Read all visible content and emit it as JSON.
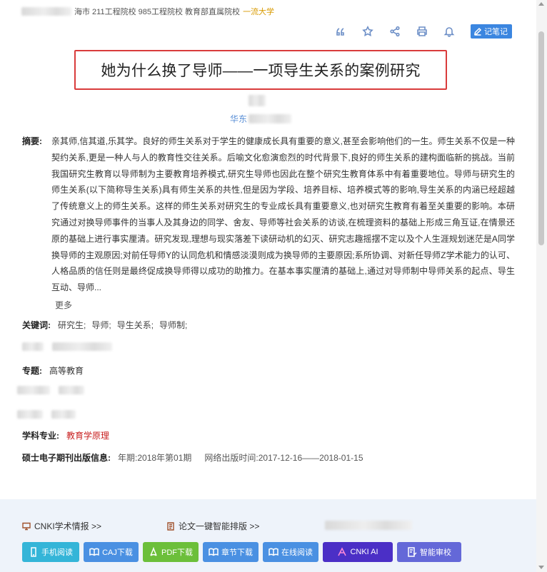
{
  "header": {
    "tags_text": "海市 211工程院校 985工程院校 教育部直属院校",
    "tag_highlight": "一流大学"
  },
  "toolbar": {
    "icons": [
      "quote-icon",
      "star-icon",
      "share-icon",
      "print-icon",
      "bell-icon"
    ],
    "note_label": "记笔记"
  },
  "paper": {
    "title": "她为什么换了导师——一项导生关系的案例研究",
    "affiliation_prefix": "华东"
  },
  "abstract": {
    "label": "摘要:",
    "text": "亲其师,信其道,乐其学。良好的师生关系对于学生的健康成长具有重要的意义,甚至会影响他们的一生。师生关系不仅是一种契约关系,更是一种人与人的教育性交往关系。后喻文化愈演愈烈的时代背景下,良好的师生关系的建构面临新的挑战。当前我国研究生教育以导师制为主要教育培养模式,研究生导师也因此在整个研究生教育体系中有着重要地位。导师与研究生的师生关系(以下简称导生关系)具有师生关系的共性,但是因为学段、培养目标、培养模式等的影响,导生关系的内涵已经超越了传统意义上的师生关系。这样的师生关系对研究生的专业成长具有重要意义,也对研究生教育有着至关重要的影响。本研究通过对换导师事件的当事人及其身边的同学、舍友、导师等社会关系的访谈,在梳理资料的基础上形成三角互证,在情景还原的基础上进行事实厘清。研究发现,理想与现实落差下读研动机的幻灭、研究志趣摇摆不定以及个人生涯规划迷茫是A同学换导师的主观原因;对前任导师Y的认同危机和情感淡漠则成为换导师的主要原因;系所协调、对新任导师Z学术能力的认可、人格品质的信任则是最终促成换导师得以成功的助推力。在基本事实厘清的基础上,通过对导师制中导师关系的起点、导生互动、导师...",
    "more_label": "更多"
  },
  "keywords": {
    "label": "关键词:",
    "items": [
      "研究生;",
      "导师;",
      "导生关系;",
      "导师制;"
    ]
  },
  "topic": {
    "label": "专题:",
    "value": "高等教育"
  },
  "discipline": {
    "label": "学科专业:",
    "value": "教育学原理"
  },
  "publication": {
    "label": "硕士电子期刊出版信息:",
    "issue_label": "年期:",
    "issue_value": "2018年第01期",
    "online_label": "网络出版时间:",
    "online_value": "2017-12-16——2018-01-15"
  },
  "footer": {
    "link_cnki": "CNKI学术情报 >>",
    "link_format": "论文一键智能排版 >>",
    "buttons": {
      "phone": "手机阅读",
      "caj": "CAJ下载",
      "pdf": "PDF下载",
      "chapter": "章节下载",
      "online": "在线阅读",
      "ai": "CNKI AI",
      "check": "智能审校"
    }
  },
  "colors": {
    "accent_blue": "#4a90e2",
    "title_border": "#d93b3b",
    "discipline_red": "#c81e1e",
    "highlight_gold": "#d89a00",
    "ai_purple": "#4b2fc6"
  }
}
